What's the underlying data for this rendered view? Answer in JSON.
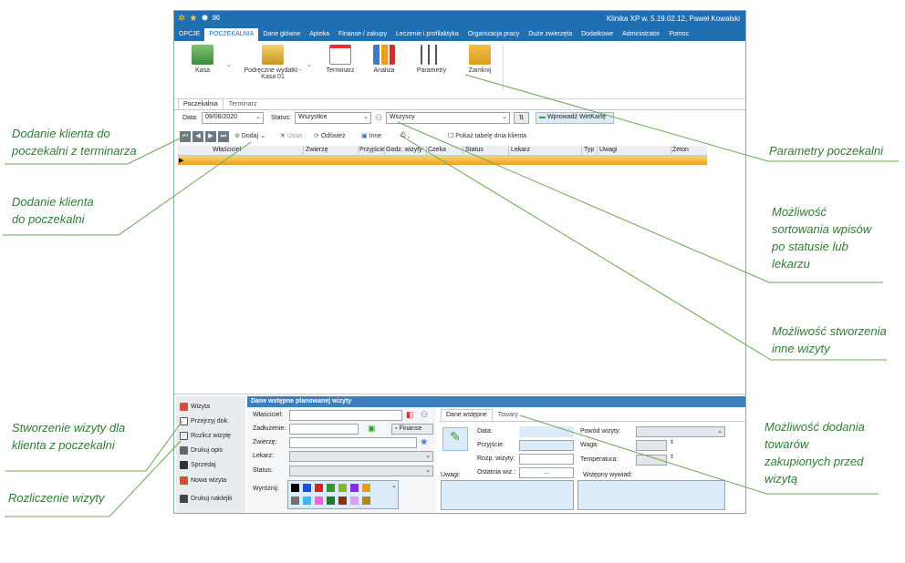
{
  "titlebar": {
    "title": "Klinika XP w. 5.19.02.12, Paweł Kowalski"
  },
  "menu": [
    "OPCJE",
    "POCZEKALNIA",
    "Dane główne",
    "Apteka",
    "Finanse / zakupy",
    "Leczenie i profilaktyka",
    "Organizacja pracy",
    "Duże zwierzęta",
    "Dodatkowe",
    "Administrator",
    "Pomoc"
  ],
  "ribbon": {
    "kasa": "Kasa",
    "wydatki_1": "Podręczne wydatki -",
    "wydatki_2": "Kasa 01",
    "terminarz": "Terminarz",
    "analiza": "Analiza",
    "parametry": "Parametry",
    "zamknij": "Zamknij"
  },
  "tabs": [
    "Poczekalnia",
    "Terminarz"
  ],
  "filter": {
    "data_label": "Data:",
    "data_value": "09/06/2020",
    "status_label": "Status:",
    "status_value": "Wszystkie",
    "lekarz_value": "Wszyscy",
    "wetkarta": "Wprowadź WetKartę"
  },
  "toolbar": {
    "dodaj": "Dodaj",
    "usun": "Usuń",
    "odswiez": "Odśwież",
    "inne": "Inne",
    "pokaz": "Pokaż tabelę dnia klienta"
  },
  "grid_columns": [
    "Właściciel",
    "Zwierzę",
    "Przyjście",
    "Godz. wizyty",
    "Czeka",
    "Status",
    "Lekarz",
    "Typ",
    "Uwagi",
    "Żeton"
  ],
  "leftmenu": [
    "Wizyta",
    "Przejrzyj dok.",
    "Rozlicz wizytę",
    "Drukuj opis",
    "Sprzedaj",
    "Nowa wizyta",
    "Drukuj naklejki"
  ],
  "panel": {
    "header": "Dane wstępne planowanej wizyty",
    "wlasciciel": "Właściciel:",
    "zadluzenie": "Zadłużenie:",
    "finanse": "Finanse",
    "zwierze": "Zwierzę:",
    "lekarz": "Lekarz:",
    "status": "Status:",
    "wyroznij": "Wyróżnij:",
    "tabs": [
      "Dane wstępne",
      "Towary"
    ],
    "data": "Data:",
    "przyjscie": "Przyjście:",
    "rozp": "Rozp. wizyty:",
    "ostatnia": "Ostatnia wiz.:",
    "ostatnia_btn": "...",
    "uwagi": "Uwagi:",
    "powod": "Powód wizyty:",
    "waga": "Waga:",
    "temperatura": "Temperatura:",
    "wywiad": "Wstępny wywiad:"
  },
  "swatches_row1": [
    "#000000",
    "#1a4fd8",
    "#e02020",
    "#2e9a2e",
    "#8ab820",
    "#8a2be2",
    "#e8a000"
  ],
  "swatches_row2": [
    "#707070",
    "#40b8f0",
    "#f060e0",
    "#207830",
    "#8a3010",
    "#d8a0f0",
    "#b08820"
  ],
  "annotations": {
    "a1_1": "Dodanie klienta do",
    "a1_2": "poczekalni z terminarza",
    "a2_1": "Dodanie klienta",
    "a2_2": "do poczekalni",
    "a3_1": "Stworzenie wizyty dla",
    "a3_2": "klienta z poczekalni",
    "a4": "Rozliczenie wizyty",
    "r1": "Parametry poczekalni",
    "r2_1": "Możliwość",
    "r2_2": "sortowania wpisów",
    "r2_3": "po statusie lub",
    "r2_4": "lekarzu",
    "r3_1": "Możliwość stworzenia",
    "r3_2": "inne wizyty",
    "r4_1": "Możliwość dodania",
    "r4_2": "towarów",
    "r4_3": "zakupionych przed",
    "r4_4": "wizytą"
  },
  "colors": {
    "accent": "#1f6fb2",
    "annot": "#2e7d32",
    "row": "#f0a020"
  }
}
